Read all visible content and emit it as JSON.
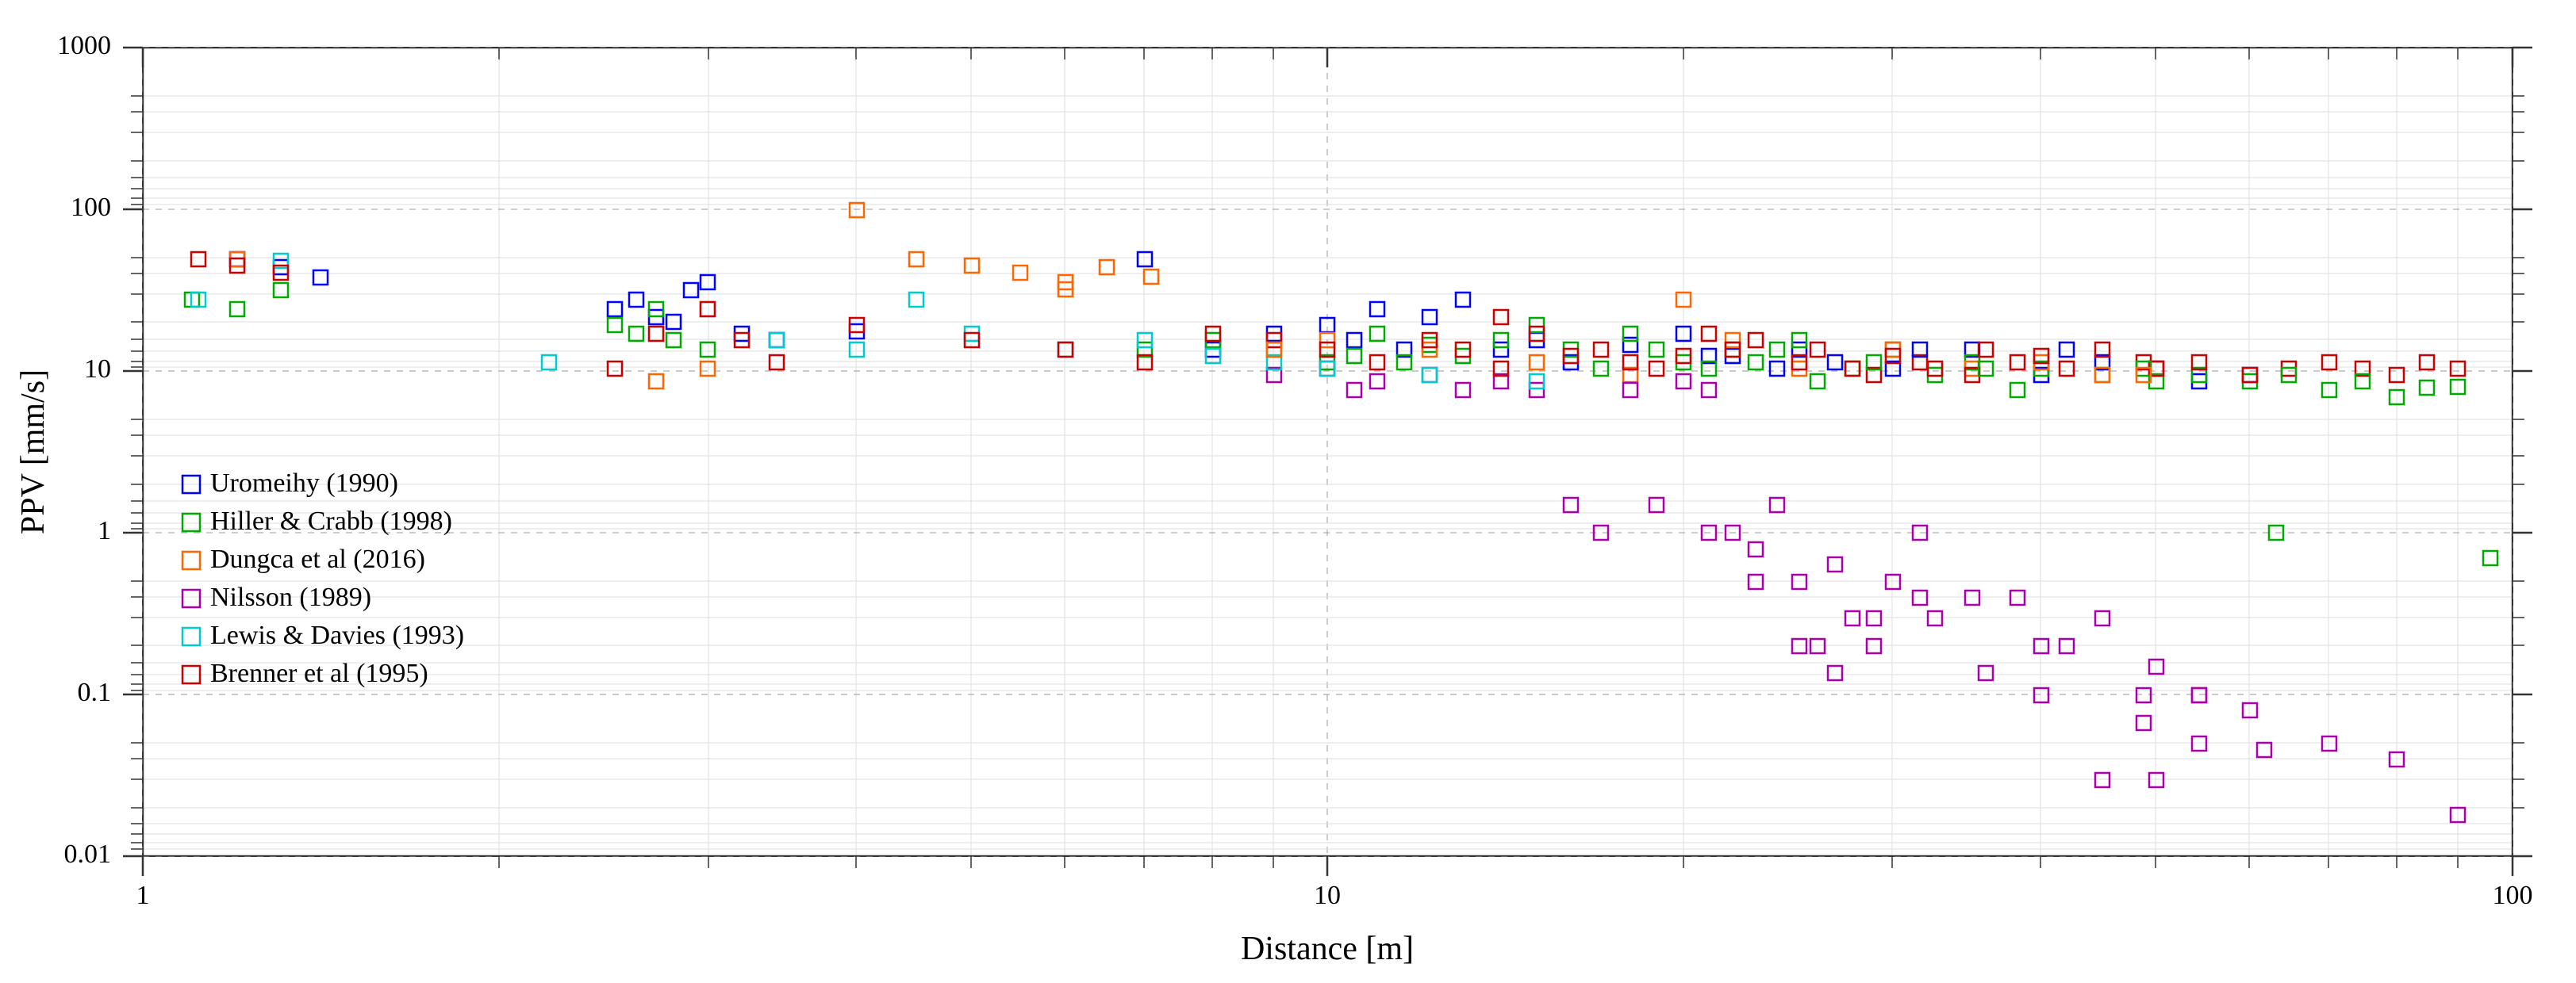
{
  "chart": {
    "title": "",
    "xAxis": {
      "label": "Distance [m]",
      "min": 1,
      "max": 100,
      "ticks": [
        "1",
        "10",
        "100"
      ],
      "minorTicks": [
        "2",
        "3",
        "4",
        "5",
        "6",
        "7",
        "8",
        "9",
        "20",
        "30",
        "40",
        "50",
        "60",
        "70",
        "80",
        "90"
      ]
    },
    "yAxis": {
      "label": "PPV [mm/s]",
      "min": 0.01,
      "max": 1000,
      "ticks": [
        "0.01",
        "0.1",
        "1",
        "10",
        "100",
        "1000"
      ],
      "minorTicks": []
    },
    "legend": [
      {
        "label": "Uromeihy (1990)",
        "color": "#0000FF",
        "shape": "square-open"
      },
      {
        "label": "Hiller & Crabb (1998)",
        "color": "#00AA00",
        "shape": "square-open"
      },
      {
        "label": "Dungca et al (2016)",
        "color": "#FF6600",
        "shape": "square-open"
      },
      {
        "label": "Nilsson (1989)",
        "color": "#AA00AA",
        "shape": "square-open"
      },
      {
        "label": "Lewis & Davies (1993)",
        "color": "#00CCCC",
        "shape": "square-open"
      },
      {
        "label": "Brenner et al (1995)",
        "color": "#CC0000",
        "shape": "square-open"
      }
    ]
  }
}
